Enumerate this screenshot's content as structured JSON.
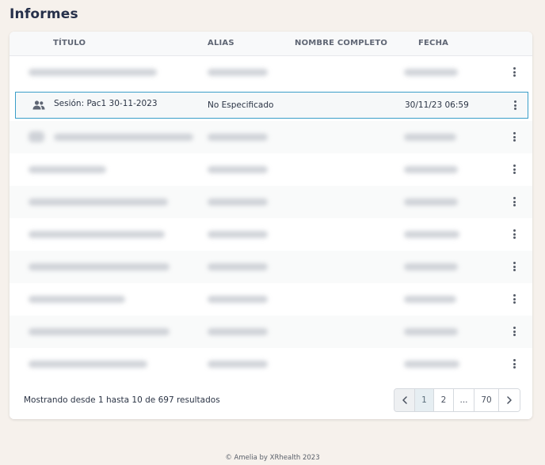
{
  "page": {
    "title": "Informes"
  },
  "table": {
    "columns": {
      "titulo": "TÍTULO",
      "alias": "ALIAS",
      "nombre": "NOMBRE COMPLETO",
      "fecha": "FECHA"
    },
    "selected_row": {
      "icon": "users-icon",
      "title": "Sesión: Pac1 30-11-2023",
      "alias": "No Especificado",
      "fecha": "30/11/23 06:59"
    }
  },
  "pagination": {
    "summary": "Mostrando desde 1 hasta 10 de 697 resultados",
    "pages": [
      "1",
      "2",
      "...",
      "70"
    ],
    "current": "1"
  },
  "footer": {
    "copyright": "© Amelia by XRhealth 2023"
  },
  "colors": {
    "page_background": "#f6f1ec",
    "selected_border": "#3a9ec9",
    "title_text": "#26304a"
  }
}
